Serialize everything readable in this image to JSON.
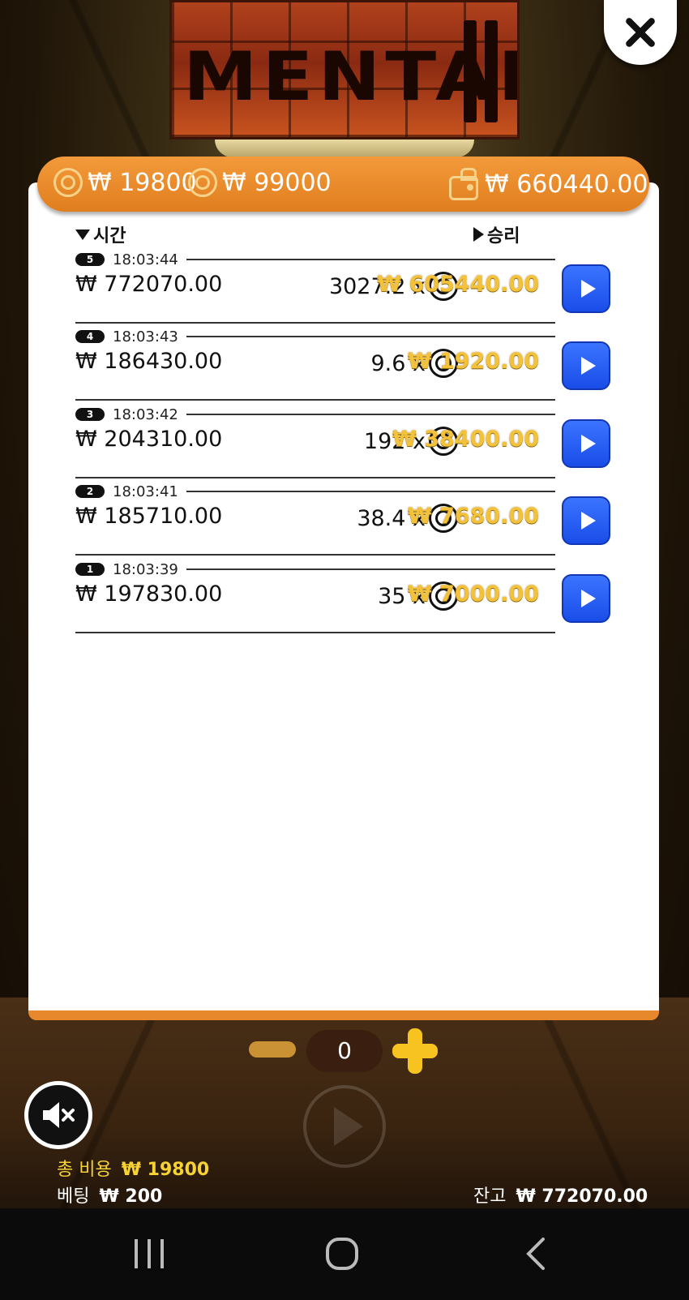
{
  "game": {
    "logo_text": "MENTAL"
  },
  "top_bar": {
    "coin1_value": "₩ 19800",
    "coin2_value": "₩ 99000",
    "wallet_value": "₩ 660440.00"
  },
  "history": {
    "col_time": "시간",
    "col_win": "승리",
    "rows": [
      {
        "badge": "5",
        "time": "18:03:44",
        "bet": "₩ 772070.00",
        "mult": "3027.2 x",
        "win": "₩ 605440.00"
      },
      {
        "badge": "4",
        "time": "18:03:43",
        "bet": "₩ 186430.00",
        "mult": "9.6 x",
        "win": "₩ 1920.00"
      },
      {
        "badge": "3",
        "time": "18:03:42",
        "bet": "₩ 204310.00",
        "mult": "192 x",
        "win": "₩ 38400.00"
      },
      {
        "badge": "2",
        "time": "18:03:41",
        "bet": "₩ 185710.00",
        "mult": "38.4 x",
        "win": "₩ 7680.00"
      },
      {
        "badge": "1",
        "time": "18:03:39",
        "bet": "₩ 197830.00",
        "mult": "35 x",
        "win": "₩ 7000.00"
      }
    ]
  },
  "controls": {
    "count": "0"
  },
  "footer": {
    "total_cost_label": "총 비용",
    "total_cost_value": "₩ 19800",
    "bet_label": "베팅",
    "bet_value": "₩ 200",
    "balance_label": "잔고",
    "balance_value": "₩ 772070.00"
  },
  "colors": {
    "accent_orange": "#e8882c",
    "win_gold": "#f3c13a",
    "play_blue": "#1a4de8"
  }
}
